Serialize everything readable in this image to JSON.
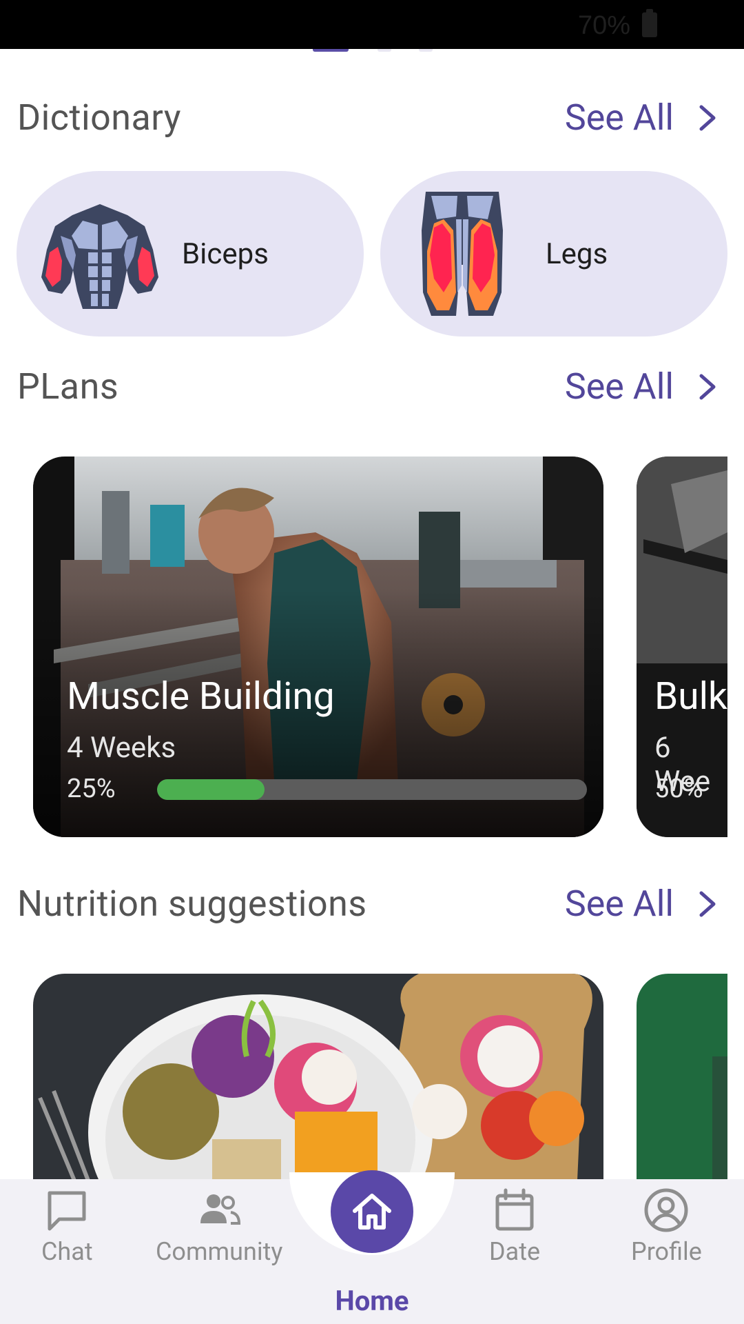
{
  "status_bar": {
    "battery": "70%"
  },
  "sections": {
    "dictionary": {
      "title": "Dictionary",
      "see_all": "See All"
    },
    "plans": {
      "title": "PLans",
      "see_all": "See All"
    },
    "nutrition": {
      "title": "Nutrition suggestions",
      "see_all": "See All"
    }
  },
  "dictionary": [
    {
      "label": "Biceps",
      "icon": "biceps-muscle-icon"
    },
    {
      "label": "Legs",
      "icon": "legs-muscle-icon"
    }
  ],
  "plans": [
    {
      "title": "Muscle Building",
      "duration": "4 Weeks",
      "progress_label": "25%",
      "progress": 0.25
    },
    {
      "title": "Bulk",
      "duration": "6 Wee",
      "progress_label": "50%",
      "progress": 0.5
    }
  ],
  "bottom_nav": {
    "items": [
      {
        "label": "Chat",
        "icon": "chat-icon"
      },
      {
        "label": "Community",
        "icon": "community-icon"
      },
      {
        "label": "Home",
        "icon": "home-icon"
      },
      {
        "label": "Date",
        "icon": "calendar-icon"
      },
      {
        "label": "Profile",
        "icon": "profile-icon"
      }
    ],
    "active": "Home"
  },
  "colors": {
    "accent": "#5a48a8",
    "card_bg": "#e6e4f4",
    "progress": "#4caf50"
  }
}
